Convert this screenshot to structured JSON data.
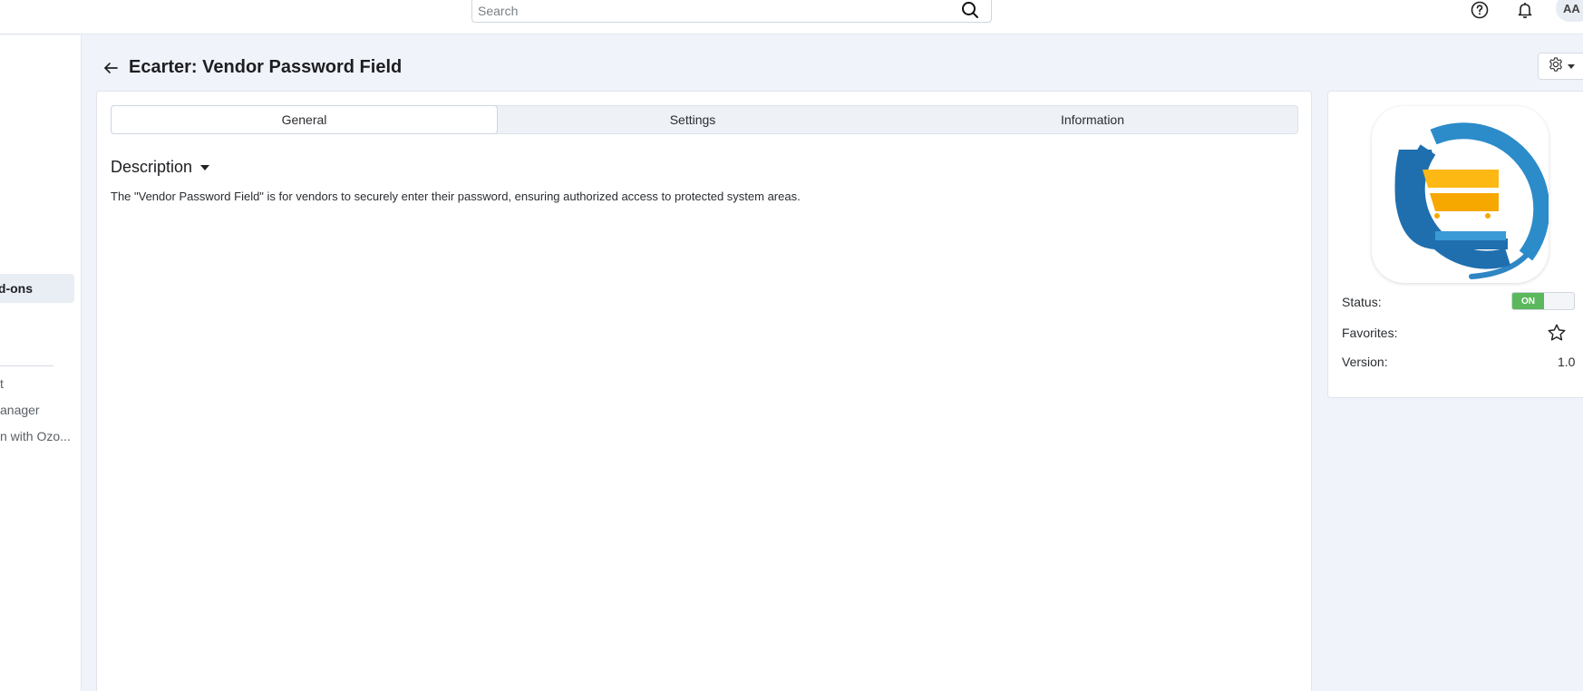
{
  "topbar": {
    "search": {
      "placeholder": "Search",
      "value": ""
    },
    "search_icon": "magnifier-icon",
    "help_icon": "question-circle-icon",
    "notifications_icon": "bell-icon",
    "avatar_initials": "AA"
  },
  "sidebar": {
    "active_item": "dd-ons",
    "items": [
      {
        "label": "t"
      },
      {
        "label": "anager"
      },
      {
        "label": "n with Ozo..."
      }
    ]
  },
  "page": {
    "title": "Ecarter: Vendor Password Field",
    "back_icon": "arrow-left-icon",
    "gear_icon": "gear-icon"
  },
  "tabs": [
    {
      "label": "General",
      "active": true
    },
    {
      "label": "Settings",
      "active": false
    },
    {
      "label": "Information",
      "active": false
    }
  ],
  "description": {
    "title": "Description",
    "text": "The \"Vendor Password Field\" is for vendors to securely enter their password, ensuring authorized access to protected system areas."
  },
  "addon_info": {
    "status_label": "Status:",
    "status_value": "ON",
    "favorites_label": "Favorites:",
    "version_label": "Version:",
    "version_value": "1.0"
  },
  "colors": {
    "accent_blue": "#2a7ab8",
    "logo_yellow": "#fdb813",
    "status_green": "#5cb85c",
    "page_bg": "#f0f3f9"
  }
}
